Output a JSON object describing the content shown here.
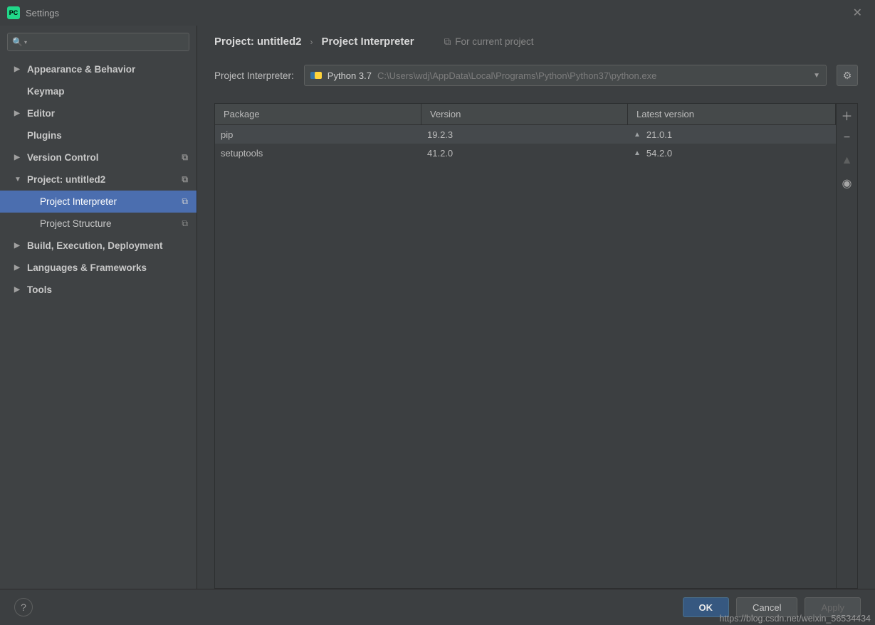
{
  "window": {
    "title": "Settings"
  },
  "sidebar": {
    "items": [
      {
        "label": "Appearance & Behavior",
        "expandable": true,
        "bold": true
      },
      {
        "label": "Keymap",
        "expandable": false,
        "bold": true
      },
      {
        "label": "Editor",
        "expandable": true,
        "bold": true
      },
      {
        "label": "Plugins",
        "expandable": false,
        "bold": true
      },
      {
        "label": "Version Control",
        "expandable": true,
        "bold": true,
        "hasCopy": true
      },
      {
        "label": "Project: untitled2",
        "expandable": true,
        "expanded": true,
        "bold": true,
        "hasCopy": true
      },
      {
        "label": "Project Interpreter",
        "sub": true,
        "selected": true,
        "hasCopy": true
      },
      {
        "label": "Project Structure",
        "sub": true,
        "hasCopy": true
      },
      {
        "label": "Build, Execution, Deployment",
        "expandable": true,
        "bold": true
      },
      {
        "label": "Languages & Frameworks",
        "expandable": true,
        "bold": true
      },
      {
        "label": "Tools",
        "expandable": true,
        "bold": true
      }
    ]
  },
  "breadcrumb": {
    "main": "Project: untitled2",
    "sep": "›",
    "sub": "Project Interpreter",
    "hint": "For current project"
  },
  "interpreter": {
    "label": "Project Interpreter:",
    "name": "Python 3.7",
    "path": "C:\\Users\\wdj\\AppData\\Local\\Programs\\Python\\Python37\\python.exe"
  },
  "packages": {
    "headers": {
      "pkg": "Package",
      "ver": "Version",
      "lat": "Latest version"
    },
    "rows": [
      {
        "name": "pip",
        "version": "19.2.3",
        "latest": "21.0.1",
        "upgrade": true,
        "selected": true
      },
      {
        "name": "setuptools",
        "version": "41.2.0",
        "latest": "54.2.0",
        "upgrade": true
      }
    ]
  },
  "footer": {
    "ok": "OK",
    "cancel": "Cancel",
    "apply": "Apply",
    "help": "?"
  },
  "watermark": "https://blog.csdn.net/weixin_56534434"
}
